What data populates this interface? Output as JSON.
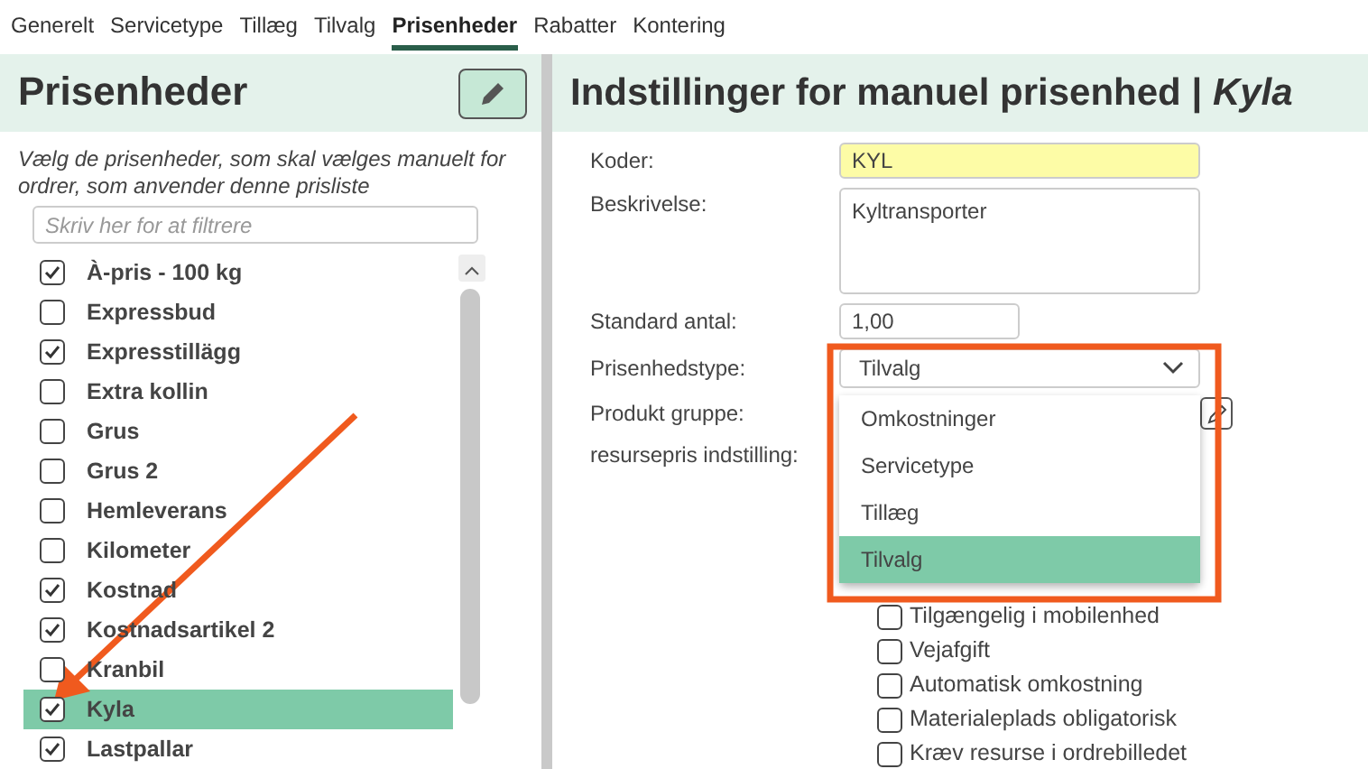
{
  "tabs": [
    {
      "label": "Generelt",
      "selected": false
    },
    {
      "label": "Servicetype",
      "selected": false
    },
    {
      "label": "Tillæg",
      "selected": false
    },
    {
      "label": "Tilvalg",
      "selected": false
    },
    {
      "label": "Prisenheder",
      "selected": true
    },
    {
      "label": "Rabatter",
      "selected": false
    },
    {
      "label": "Kontering",
      "selected": false
    }
  ],
  "left": {
    "title": "Prisenheder",
    "hint": "Vælg de prisenheder, som skal vælges manuelt for ordrer, som anvender denne prisliste",
    "filter": {
      "placeholder": "Skriv her for at filtrere"
    },
    "items": [
      {
        "label": "À-pris - 100 kg",
        "checked": true,
        "selected": false
      },
      {
        "label": "Expressbud",
        "checked": false,
        "selected": false
      },
      {
        "label": "Expresstillägg",
        "checked": true,
        "selected": false
      },
      {
        "label": "Extra kollin",
        "checked": false,
        "selected": false
      },
      {
        "label": "Grus",
        "checked": false,
        "selected": false
      },
      {
        "label": "Grus 2",
        "checked": false,
        "selected": false
      },
      {
        "label": "Hemleverans",
        "checked": false,
        "selected": false
      },
      {
        "label": "Kilometer",
        "checked": false,
        "selected": false
      },
      {
        "label": "Kostnad",
        "checked": true,
        "selected": false
      },
      {
        "label": "Kostnadsartikel 2",
        "checked": true,
        "selected": false
      },
      {
        "label": "Kranbil",
        "checked": false,
        "selected": false
      },
      {
        "label": "Kyla",
        "checked": true,
        "selected": true
      },
      {
        "label": "Lastpallar",
        "checked": true,
        "selected": false
      }
    ]
  },
  "right": {
    "title": "Indstillinger for manuel prisenhed | *Kyla*",
    "fields": [
      {
        "kind": "code",
        "label": "Koder:",
        "value": "KYL"
      },
      {
        "kind": "textarea",
        "label": "Beskrivelse:",
        "value": "Kyltransporter"
      },
      {
        "kind": "short",
        "label": "Standard antal:",
        "value": "1,00"
      },
      {
        "kind": "select",
        "label": "Prisenhedstype:",
        "value": "Tilvalg",
        "expanded": true,
        "options": [
          {
            "label": "Omkostninger",
            "selected": false
          },
          {
            "label": "Servicetype",
            "selected": false
          },
          {
            "label": "Tillæg",
            "selected": false
          },
          {
            "label": "Tilvalg",
            "selected": true
          }
        ]
      },
      {
        "kind": "button",
        "label": "Produkt gruppe:"
      },
      {
        "kind": "label",
        "label": "resursepris indstilling:"
      }
    ],
    "checkboxes": [
      {
        "label": "Tilgængelig i mobilenhed",
        "checked": false
      },
      {
        "label": "Vejafgift",
        "checked": false
      },
      {
        "label": "Automatisk omkostning",
        "checked": false
      },
      {
        "label": "Materialeplads obligatorisk",
        "checked": false
      },
      {
        "label": "Kræv resurse i ordrebilledet",
        "checked": false
      }
    ]
  }
}
